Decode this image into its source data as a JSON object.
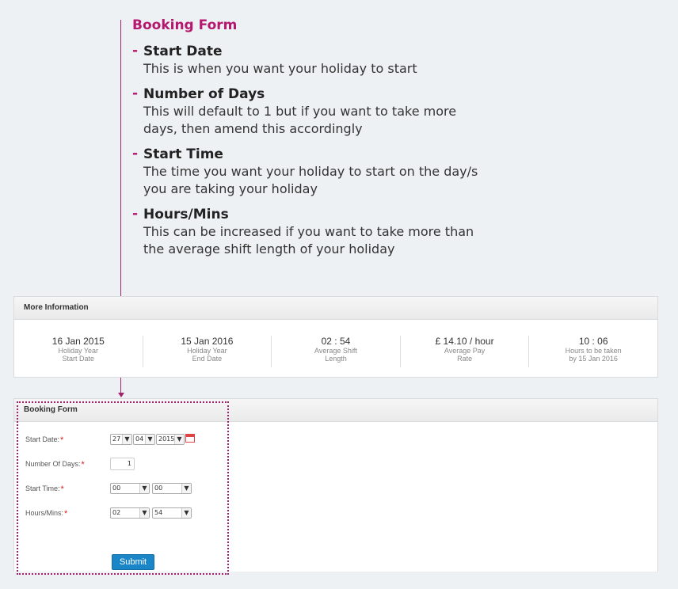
{
  "help": {
    "title": "Booking Form",
    "items": [
      {
        "heading": "Start Date",
        "text": "This is when you want your holiday to start"
      },
      {
        "heading": "Number of Days",
        "text": "This will default to 1 but if you want to take more days, then amend this accordingly"
      },
      {
        "heading": "Start Time",
        "text": "The time you want your holiday to start on the day/s you are taking your holiday"
      },
      {
        "heading": "Hours/Mins",
        "text": "This can be increased if you want to take more than the average shift length of your holiday"
      }
    ]
  },
  "more_info": {
    "title": "More Information",
    "cols": [
      {
        "value": "16 Jan 2015",
        "label1": "Holiday Year",
        "label2": "Start Date"
      },
      {
        "value": "15 Jan 2016",
        "label1": "Holiday Year",
        "label2": "End Date"
      },
      {
        "value": "02 : 54",
        "label1": "Average Shift",
        "label2": "Length"
      },
      {
        "value": "£ 14.10 / hour",
        "label1": "Average Pay",
        "label2": "Rate"
      },
      {
        "value": "10 : 06",
        "label1": "Hours to be taken",
        "label2": "by 15 Jan 2016"
      }
    ]
  },
  "booking": {
    "title": "Booking Form",
    "start_date_label": "Start Date:",
    "num_days_label": "Number Of Days:",
    "start_time_label": "Start Time:",
    "hours_label": "Hours/Mins:",
    "required": "*",
    "day": "27",
    "month": "04",
    "year": "2015",
    "num_days": "1",
    "start_hour": "00",
    "start_min": "00",
    "hours": "02",
    "mins": "54",
    "submit": "Submit",
    "arrow": "▼"
  }
}
